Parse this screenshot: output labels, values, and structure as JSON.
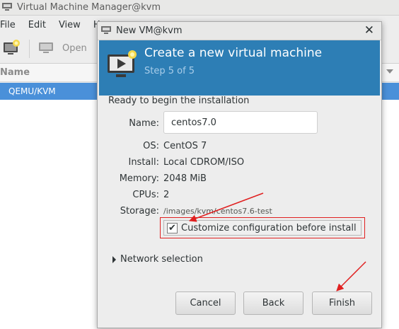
{
  "main_window": {
    "title": "Virtual Machine Manager@kvm",
    "menu": [
      "File",
      "Edit",
      "View",
      "H"
    ],
    "toolbar": {
      "open_label": "Open"
    },
    "list_header": "Name",
    "list_rows": [
      "QEMU/KVM"
    ]
  },
  "dialog": {
    "title": "New VM@kvm",
    "close_glyph": "✕",
    "header_title": "Create a new virtual machine",
    "header_step": "Step 5 of 5",
    "ready_text": "Ready to begin the installation",
    "name_label": "Name:",
    "name_value": "centos7.0",
    "summary": {
      "os_label": "OS:",
      "os_value": "CentOS 7",
      "install_label": "Install:",
      "install_value": "Local CDROM/ISO",
      "memory_label": "Memory:",
      "memory_value": "2048 MiB",
      "cpus_label": "CPUs:",
      "cpus_value": "2",
      "storage_label": "Storage:",
      "storage_value": "/images/kvm/centos7.6-test"
    },
    "customize_label": "Customize configuration before install",
    "customize_checked": true,
    "network_label": "Network selection",
    "buttons": {
      "cancel": "Cancel",
      "back": "Back",
      "finish": "Finish"
    }
  },
  "colors": {
    "header_blue": "#2d7eb5",
    "selection_blue": "#4a90d9",
    "annotation_red": "#e02020"
  },
  "icons": [
    "monitor-icon",
    "monitor-star-icon",
    "open-monitor-icon",
    "monitor-play-icon",
    "close-icon",
    "checkmark-icon",
    "expander-arrow-icon"
  ]
}
